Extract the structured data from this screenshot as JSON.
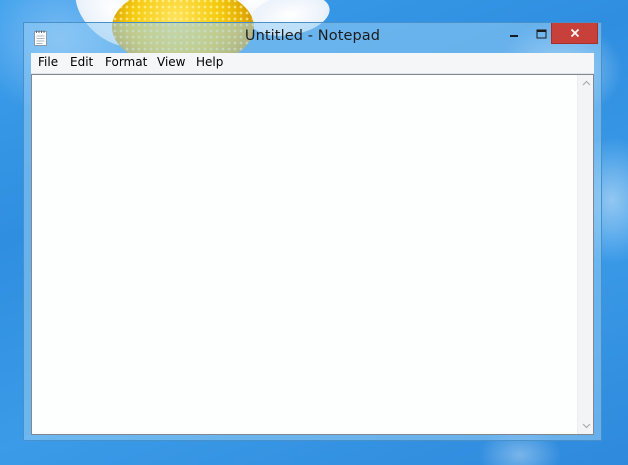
{
  "window": {
    "title": "Untitled - Notepad"
  },
  "menu": {
    "items": [
      "File",
      "Edit",
      "Format",
      "View",
      "Help"
    ]
  },
  "editor": {
    "value": ""
  },
  "icons": {
    "app": "notepad-icon",
    "minimize": "minimize-icon",
    "maximize": "maximize-icon",
    "close": "close-icon",
    "scroll_up": "chevron-up-icon",
    "scroll_down": "chevron-down-icon"
  },
  "colors": {
    "desktop": "#2f8ee0",
    "close_button": "#c7403a",
    "window_frame": "#96cdf5",
    "editor_bg": "#fdfefe"
  }
}
